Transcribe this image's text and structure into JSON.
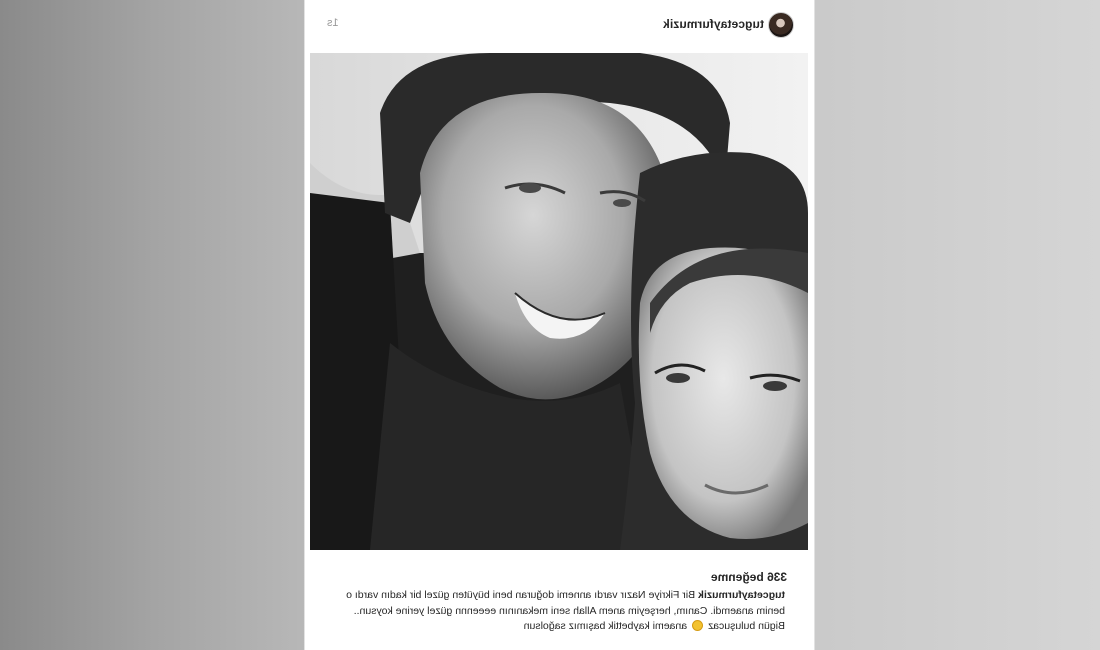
{
  "post": {
    "username": "tugcetayfurmuzik",
    "time_ago": "1s",
    "likes_text": "336 beğenme",
    "caption": {
      "username": "tugcetayfurmuzik",
      "text_before_emoji": "Bir Fikriye Nazır vardı annemi doğuran beni büyüten güzel bir kadın vardı o benim anaemdi. Canım, herşeyim anem Allah seni mekanının eeeennn güzel yerine koysun.. Bigün buluşucaz",
      "emoji": "crying-face-emoji",
      "text_after_emoji": "anaemi kaybettik başımız sağolsun"
    }
  },
  "colors": {
    "page_bg_left": "#8a8a8a",
    "page_bg_right": "#d5d5d5",
    "card_bg": "#ffffff",
    "text": "#262626",
    "muted_text": "#9a9a9a"
  }
}
